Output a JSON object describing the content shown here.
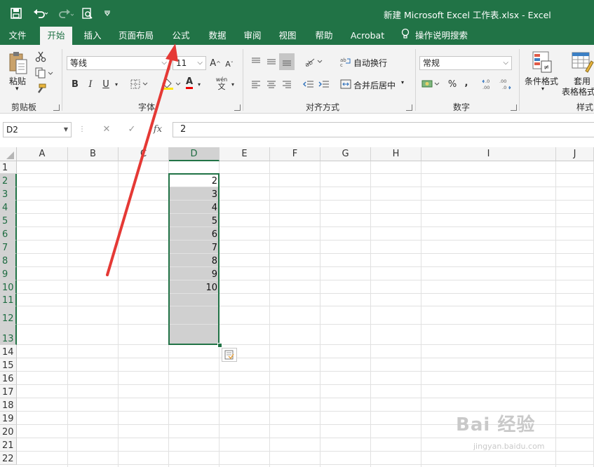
{
  "title_bar": {
    "document_title": "新建 Microsoft Excel 工作表.xlsx  -  Excel",
    "quick_access": [
      {
        "name": "save-icon",
        "glyph": "💾"
      },
      {
        "name": "undo-icon",
        "glyph": "↶"
      },
      {
        "name": "redo-icon",
        "glyph": "↷"
      },
      {
        "name": "print-preview-icon",
        "glyph": "🔍"
      },
      {
        "name": "customize-icon",
        "glyph": "▾"
      }
    ]
  },
  "menu_tabs": [
    "文件",
    "开始",
    "插入",
    "页面布局",
    "公式",
    "数据",
    "审阅",
    "视图",
    "帮助",
    "Acrobat",
    "操作说明搜索"
  ],
  "active_tab": "开始",
  "ribbon": {
    "clipboard": {
      "paste_label": "粘贴",
      "group_title": "剪贴板"
    },
    "font": {
      "font_name": "等线",
      "font_size": "11",
      "group_title": "字体",
      "bold": "B",
      "italic": "I",
      "underline": "U",
      "font_color_glyph": "A",
      "phonetic_glyph": "wén"
    },
    "alignment": {
      "wrap_text": "自动换行",
      "merge_center": "合并后居中",
      "group_title": "对齐方式"
    },
    "number": {
      "format": "常规",
      "percent": "%",
      "comma": ",",
      "group_title": "数字",
      "inc_decimal": "←.0 .00",
      "dec_decimal": ".00 →.0"
    },
    "styles": {
      "conditional_format": "条件格式",
      "table_format_1": "套用",
      "table_format_2": "表格格式",
      "group_title": "样式"
    }
  },
  "formula_bar": {
    "name_box": "D2",
    "formula": "2",
    "cancel": "✕",
    "enter": "✓",
    "fx": "fx"
  },
  "columns": [
    "A",
    "B",
    "C",
    "D",
    "E",
    "F",
    "G",
    "H",
    "I",
    "J"
  ],
  "rows": [
    "1",
    "2",
    "3",
    "4",
    "5",
    "6",
    "7",
    "8",
    "9",
    "10",
    "11",
    "12",
    "13",
    "14",
    "15",
    "16",
    "17",
    "18",
    "19",
    "20",
    "21",
    "22"
  ],
  "selected_column": "D",
  "selected_range": "D2:D13",
  "cells": [
    {
      "ref": "D2",
      "value": "2"
    },
    {
      "ref": "D3",
      "value": "3"
    },
    {
      "ref": "D4",
      "value": "4"
    },
    {
      "ref": "D5",
      "value": "5"
    },
    {
      "ref": "D6",
      "value": "6"
    },
    {
      "ref": "D7",
      "value": "7"
    },
    {
      "ref": "D8",
      "value": "8"
    },
    {
      "ref": "D9",
      "value": "9"
    },
    {
      "ref": "D10",
      "value": "10"
    }
  ],
  "watermark": {
    "main": "Bai 经验",
    "sub": "jingyan.baidu.com"
  },
  "colors": {
    "excel_green": "#217346",
    "annotation_arrow": "#e53935",
    "selection_fill": "#d0d0d0"
  }
}
